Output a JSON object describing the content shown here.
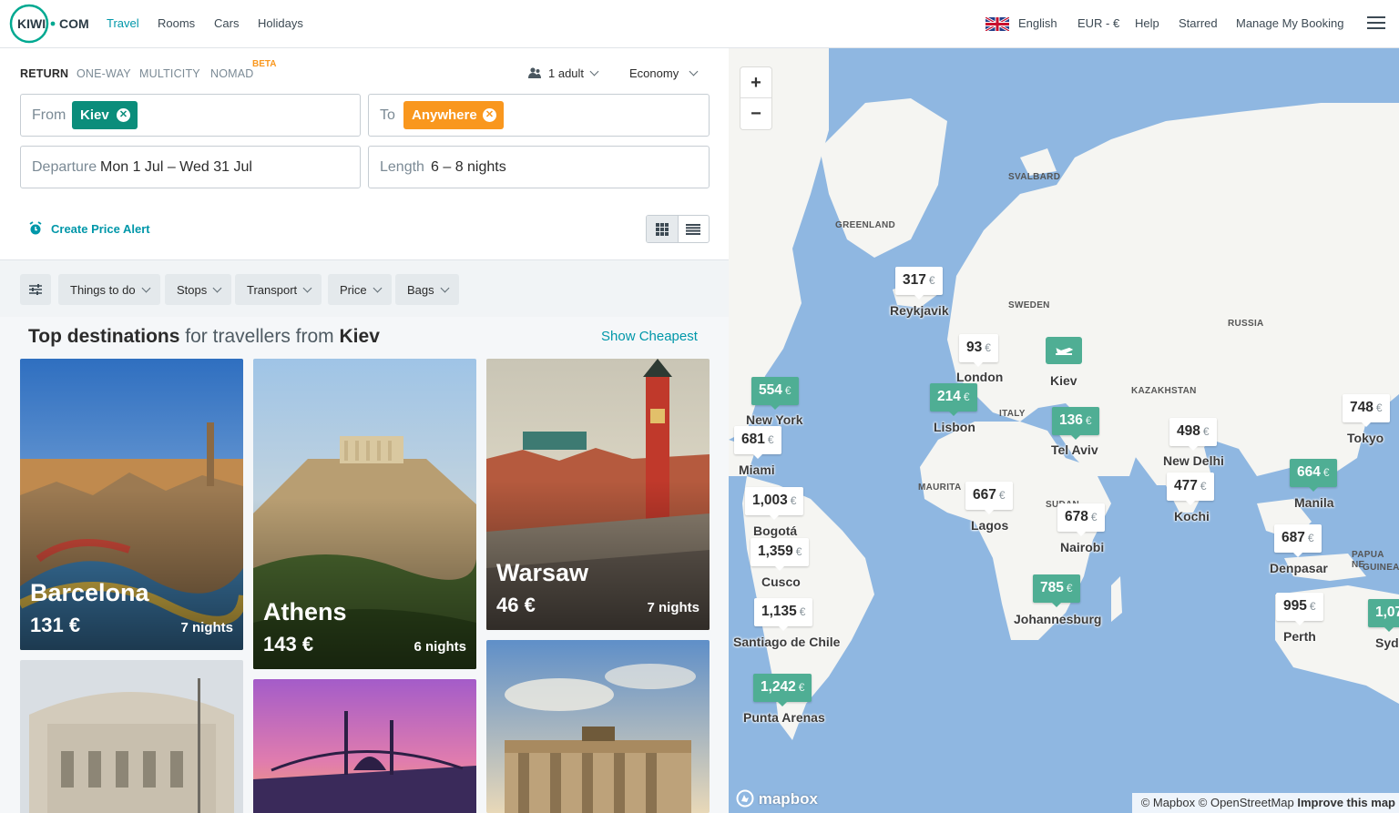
{
  "header": {
    "logo_text": "KIWI",
    "logo_suffix": "COM",
    "nav": [
      "Travel",
      "Rooms",
      "Cars",
      "Holidays"
    ],
    "language": "English",
    "currency": "EUR - €",
    "help": "Help",
    "starred": "Starred",
    "manage_booking": "Manage My Booking"
  },
  "search": {
    "trip_types": [
      "RETURN",
      "ONE-WAY",
      "MULTICITY",
      "NOMAD"
    ],
    "beta": "BETA",
    "passengers": "1 adult",
    "cabin": "Economy",
    "from_label": "From",
    "from_value": "Kiev",
    "to_label": "To",
    "to_value": "Anywhere",
    "departure_label": "Departure",
    "departure_value": "Mon 1 Jul – Wed 31 Jul",
    "length_label": "Length",
    "length_value": "6 – 8 nights",
    "price_alert": "Create Price Alert"
  },
  "filters": [
    "Things to do",
    "Stops",
    "Transport",
    "Price",
    "Bags"
  ],
  "destinations": {
    "title_bold": "Top destinations",
    "title_mid": "for travellers from",
    "origin": "Kiev",
    "show_cheapest": "Show Cheapest",
    "cards": [
      {
        "city": "Barcelona",
        "price": "131 €",
        "nights": "7 nights"
      },
      {
        "city": "Athens",
        "price": "143 €",
        "nights": "6 nights"
      },
      {
        "city": "Warsaw",
        "price": "46 €",
        "nights": "7 nights"
      }
    ]
  },
  "map": {
    "zoom_in": "+",
    "zoom_out": "−",
    "regions": [
      "GREENLAND",
      "SVALBARD",
      "SWEDEN",
      "RUSSIA",
      "KAZAKHSTAN",
      "ITALY",
      "MAURITA",
      "SUDAN",
      "PAPUA NE",
      "GUINEA"
    ],
    "origin": "Kiev",
    "pins": [
      {
        "price": "317",
        "city": "Reykjavik",
        "green": false
      },
      {
        "price": "93",
        "city": "London",
        "green": false
      },
      {
        "price": "554",
        "city": "New York",
        "green": true
      },
      {
        "price": "214",
        "city": "Lisbon",
        "green": true
      },
      {
        "price": "136",
        "city": "Tel Aviv",
        "green": true
      },
      {
        "price": "498",
        "city": "New Delhi",
        "green": false
      },
      {
        "price": "748",
        "city": "Tokyo",
        "green": false
      },
      {
        "price": "681",
        "city": "Miami",
        "green": false
      },
      {
        "price": "1,003",
        "city": "Bogotá",
        "green": false
      },
      {
        "price": "667",
        "city": "Lagos",
        "green": false
      },
      {
        "price": "678",
        "city": "Nairobi",
        "green": false
      },
      {
        "price": "477",
        "city": "Kochi",
        "green": false
      },
      {
        "price": "664",
        "city": "Manila",
        "green": true
      },
      {
        "price": "1,359",
        "city": "Cusco",
        "green": false
      },
      {
        "price": "687",
        "city": "Denpasar",
        "green": false
      },
      {
        "price": "785",
        "city": "Johannesburg",
        "green": true
      },
      {
        "price": "1,135",
        "city": "Santiago de Chile",
        "green": false
      },
      {
        "price": "995",
        "city": "Perth",
        "green": false
      },
      {
        "price": "1,07",
        "city": "Syd",
        "green": true
      },
      {
        "price": "1,242",
        "city": "Punta Arenas",
        "green": true
      }
    ],
    "currency_symbol": "€",
    "mapbox": "mapbox",
    "attribution_mapbox": "© Mapbox",
    "attribution_osm": "© OpenStreetMap",
    "attribution_improve": "Improve this map"
  },
  "colors": {
    "accent": "#0097a9",
    "from_chip": "#0b8d7b",
    "to_chip": "#f9971e",
    "map_water": "#8fb7e1",
    "pin_green": "#4fae94"
  }
}
